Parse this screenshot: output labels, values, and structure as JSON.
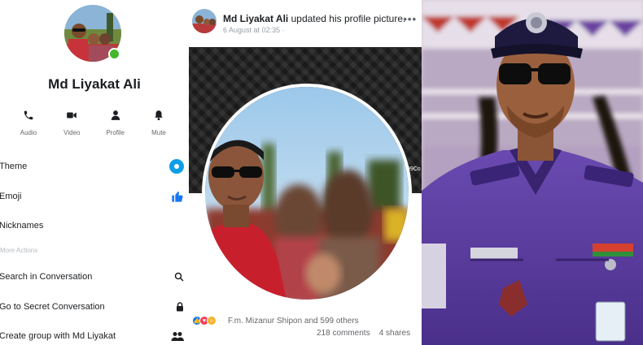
{
  "contact": {
    "name": "Md Liyakat Ali",
    "online": true
  },
  "actions": [
    {
      "label": "Audio",
      "icon": "phone-icon"
    },
    {
      "label": "Video",
      "icon": "video-camera-icon"
    },
    {
      "label": "Profile",
      "icon": "person-icon"
    },
    {
      "label": "Mute",
      "icon": "bell-icon"
    }
  ],
  "menu": {
    "theme": "Theme",
    "emoji": "Emoji",
    "nicknames": "Nicknames",
    "more_actions": "More Actions",
    "search": "Search in Conversation",
    "secret": "Go to Secret Conversation",
    "group": "Create group with Md Liyakat"
  },
  "post": {
    "author": "Md Liyakat Ali",
    "action_text": "updated his profile picture.",
    "time": "6 August at 02:35 ·",
    "more": "•••",
    "reactions_text": "F.m. Mizanur Shipon and 599 others",
    "comments": "218 comments",
    "shares": "4 shares",
    "edge_label": "99Co"
  },
  "colors": {
    "accent": "#0d9ee8",
    "online": "#42b72a",
    "uniform": "#5b3d9a"
  }
}
